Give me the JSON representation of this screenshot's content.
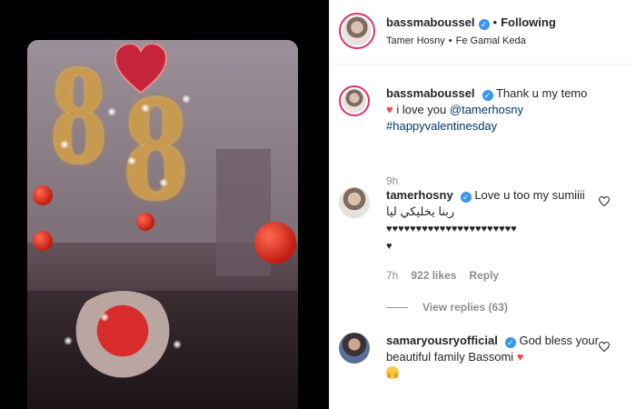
{
  "post": {
    "author": "bassmaboussel",
    "follow_state": "Following",
    "audio": {
      "artist": "Tamer Hosny",
      "track": "Fe Gamal Keda"
    }
  },
  "comments": [
    {
      "username": "bassmaboussel",
      "text_before": "Thank u my temo",
      "text_middle": "i love you",
      "mention": "@tamerhosny",
      "hashtag": "#happyvalentinesday",
      "time": "9h"
    },
    {
      "username": "tamerhosny",
      "text_line1": "Love u too my sumiiii",
      "text_arabic": "ربنا يخليكي ليا",
      "hearts": "♥♥♥♥♥♥♥♥♥♥♥♥♥♥♥♥♥♥♥♥♥♥",
      "hearts_last": "♥",
      "time": "7h",
      "likes": "922 likes",
      "reply_label": "Reply",
      "view_replies": "View replies (63)"
    },
    {
      "username": "samaryousryofficial",
      "text": "God bless your beautiful family Bassomi"
    }
  ],
  "icons": {
    "verified": "verified-badge-icon",
    "like": "heart-outline-icon",
    "more": "more-options-icon"
  },
  "colors": {
    "verified_blue": "#3897f0",
    "link_blue": "#00376b",
    "heart_red": "#ed4956",
    "meta_gray": "#8e8e8e",
    "story_ring": "#e1306c"
  }
}
